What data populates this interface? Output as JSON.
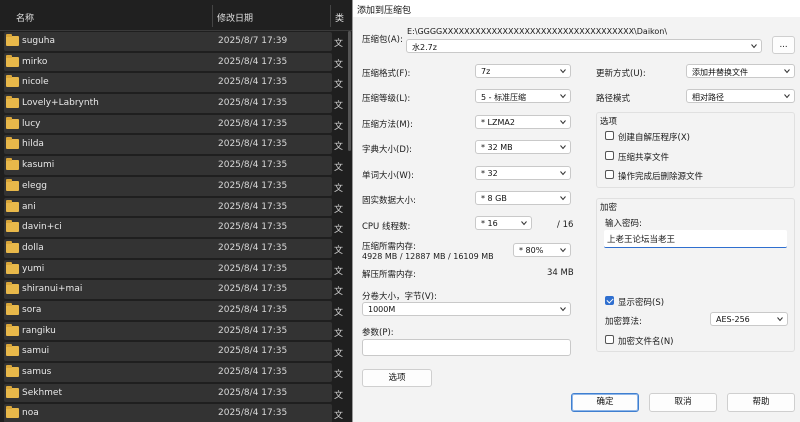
{
  "explorer": {
    "columns": {
      "name": "名称",
      "date": "修改日期",
      "type": "类"
    },
    "rows": [
      {
        "name": "suguha",
        "date": "2025/8/7 17:39",
        "type": "文"
      },
      {
        "name": "mirko",
        "date": "2025/8/4 17:35",
        "type": "文"
      },
      {
        "name": "nicole",
        "date": "2025/8/4 17:35",
        "type": "文"
      },
      {
        "name": "Lovely+Labrynth",
        "date": "2025/8/4 17:35",
        "type": "文"
      },
      {
        "name": "lucy",
        "date": "2025/8/4 17:35",
        "type": "文"
      },
      {
        "name": "hilda",
        "date": "2025/8/4 17:35",
        "type": "文"
      },
      {
        "name": "kasumi",
        "date": "2025/8/4 17:35",
        "type": "文"
      },
      {
        "name": "elegg",
        "date": "2025/8/4 17:35",
        "type": "文"
      },
      {
        "name": "ani",
        "date": "2025/8/4 17:35",
        "type": "文"
      },
      {
        "name": "davin+ci",
        "date": "2025/8/4 17:35",
        "type": "文"
      },
      {
        "name": "dolla",
        "date": "2025/8/4 17:35",
        "type": "文"
      },
      {
        "name": "yumi",
        "date": "2025/8/4 17:35",
        "type": "文"
      },
      {
        "name": "shiranui+mai",
        "date": "2025/8/4 17:35",
        "type": "文"
      },
      {
        "name": "sora",
        "date": "2025/8/4 17:35",
        "type": "文"
      },
      {
        "name": "rangiku",
        "date": "2025/8/4 17:35",
        "type": "文"
      },
      {
        "name": "samui",
        "date": "2025/8/4 17:35",
        "type": "文"
      },
      {
        "name": "samus",
        "date": "2025/8/4 17:35",
        "type": "文"
      },
      {
        "name": "Sekhmet",
        "date": "2025/8/4 17:35",
        "type": "文"
      },
      {
        "name": "noa",
        "date": "2025/8/4 17:35",
        "type": "文"
      }
    ]
  },
  "dialog": {
    "title": "添加到压缩包",
    "archive_label": "压缩包(A):",
    "archive_path": "E:\\GGGGXXXXXXXXXXXXXXXXXXXXXXXXXXXXXXXXXXX\\Daikon\\",
    "archive_name": "水2.7z",
    "browse_label": "...",
    "format_label": "压缩格式(F):",
    "format_value": "7z",
    "level_label": "压缩等级(L):",
    "level_value": "5 - 标准压缩",
    "method_label": "压缩方法(M):",
    "method_value": "* LZMA2",
    "dict_label": "字典大小(D):",
    "dict_value": "* 32 MB",
    "word_label": "单词大小(W):",
    "word_value": "* 32",
    "solid_label": "固实数据大小:",
    "solid_value": "* 8 GB",
    "cpu_label": "CPU 线程数:",
    "cpu_value": "* 16",
    "cpu_total": "/ 16",
    "mem_label": "压缩所需内存:",
    "mem_detail": "4928 MB / 12887 MB / 16109 MB",
    "mem_value": "* 80%",
    "decomp_label": "解压所需内存:",
    "decomp_value": "34 MB",
    "split_label": "分卷大小，字节(V):",
    "split_value": "1000M",
    "params_label": "参数(P):",
    "params_value": "",
    "options_button": "选项",
    "update_label": "更新方式(U):",
    "update_value": "添加并替换文件",
    "path_label": "路径模式",
    "path_value": "相对路径",
    "options_group": "选项",
    "opt_sfx": "创建自解压程序(X)",
    "opt_shared": "压缩共享文件",
    "opt_delete": "操作完成后删除源文件",
    "encrypt_group": "加密",
    "password_label": "输入密码:",
    "password_value": "上老王论坛当老王",
    "show_password": "显示密码(S)",
    "enc_method_label": "加密算法:",
    "enc_method_value": "AES-256",
    "enc_names": "加密文件名(N)",
    "ok": "确定",
    "cancel": "取消",
    "help": "帮助"
  }
}
